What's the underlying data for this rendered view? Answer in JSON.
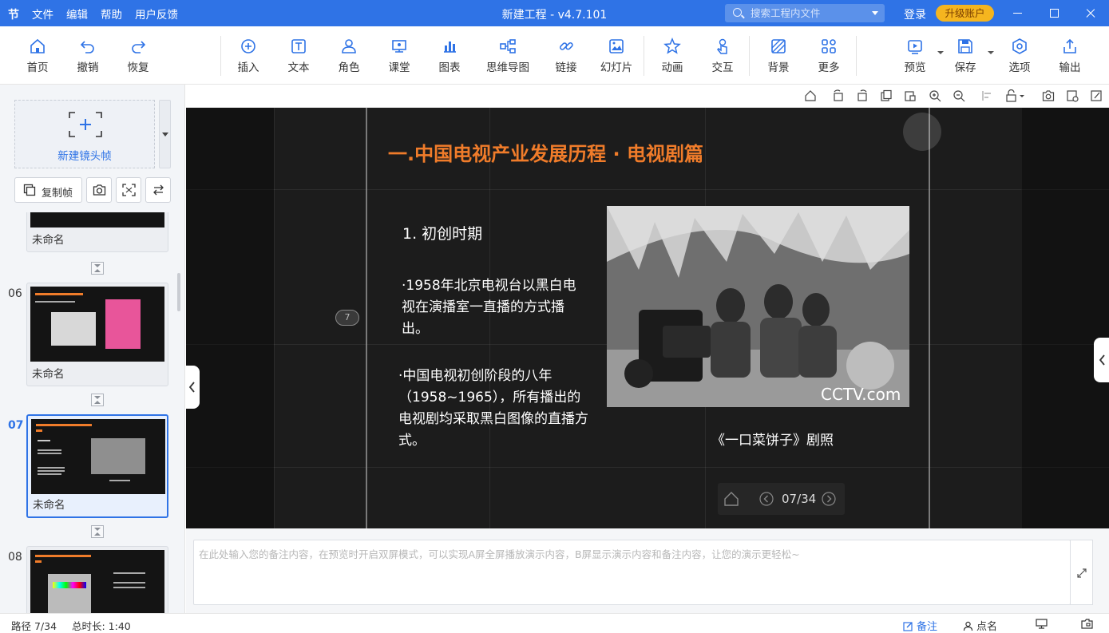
{
  "titlebar": {
    "logo": "节",
    "menu": [
      "文件",
      "编辑",
      "帮助",
      "用户反馈"
    ],
    "title": "新建工程 - v4.7.101",
    "search_placeholder": "搜索工程内文件",
    "login": "登录",
    "upgrade": "升级账户",
    "accent": "#2f73e6"
  },
  "toolbar": {
    "items": [
      {
        "label": "首页",
        "icon": "home-icon"
      },
      {
        "label": "撤销",
        "icon": "undo-icon"
      },
      {
        "label": "恢复",
        "icon": "redo-icon"
      },
      {
        "label": "插入",
        "icon": "plus-circle-icon"
      },
      {
        "label": "文本",
        "icon": "text-icon"
      },
      {
        "label": "角色",
        "icon": "person-icon"
      },
      {
        "label": "课堂",
        "icon": "classroom-icon"
      },
      {
        "label": "图表",
        "icon": "chart-icon"
      },
      {
        "label": "思维导图",
        "icon": "mindmap-icon"
      },
      {
        "label": "链接",
        "icon": "link-icon"
      },
      {
        "label": "幻灯片",
        "icon": "slide-icon"
      },
      {
        "label": "动画",
        "icon": "star-icon"
      },
      {
        "label": "交互",
        "icon": "hand-icon"
      },
      {
        "label": "背景",
        "icon": "background-icon"
      },
      {
        "label": "更多",
        "icon": "grid-icon"
      },
      {
        "label": "预览",
        "icon": "play-icon"
      },
      {
        "label": "保存",
        "icon": "save-icon"
      },
      {
        "label": "选项",
        "icon": "options-icon"
      },
      {
        "label": "输出",
        "icon": "export-icon"
      }
    ]
  },
  "left": {
    "new_frame": "新建镜头帧",
    "copy_frame": "复制帧",
    "frames": [
      {
        "num": "",
        "label": "未命名"
      },
      {
        "num": "06",
        "label": "未命名"
      },
      {
        "num": "07",
        "label": "未命名",
        "selected": true
      },
      {
        "num": "08",
        "label": ""
      }
    ]
  },
  "slide": {
    "title": "一.中国电视产业发展历程 · 电视剧篇",
    "subtitle": "1. 初创时期",
    "bullet1": "·1958年北京电视台以黑白电视在演播室一直播的方式播出。",
    "bullet2": "·中国电视初创阶段的八年（1958~1965），所有播出的电视剧均采取黑白图像的直播方式。",
    "caption": "《一口菜饼子》剧照",
    "watermark": "CCTV.com",
    "badge": "7",
    "page": "07/34",
    "title_color": "#f07c2a"
  },
  "notes": {
    "placeholder": "在此处输入您的备注内容，在预览时开启双屏模式，可以实现A屏全屏播放演示内容，B屏显示演示内容和备注内容，让您的演示更轻松~"
  },
  "status": {
    "path": "路径 7/34",
    "duration": "总时长: 1:40",
    "notes": "备注",
    "rollcall": "点名"
  }
}
